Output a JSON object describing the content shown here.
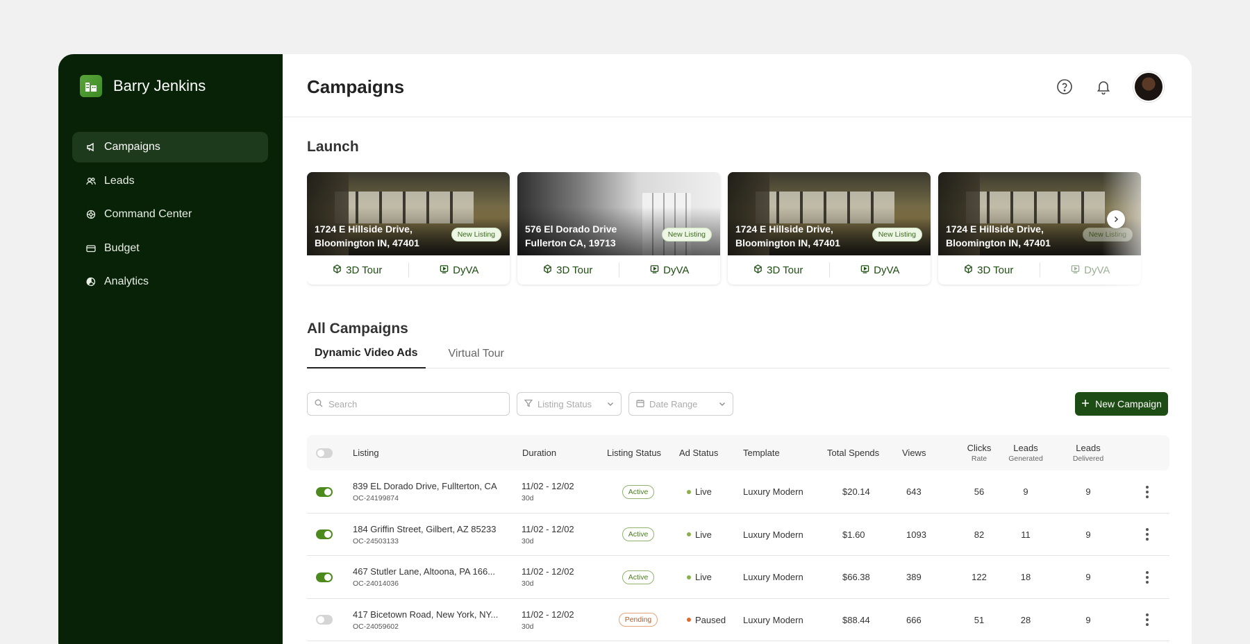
{
  "sidebar": {
    "brand_name": "Barry Jenkins",
    "items": [
      {
        "label": "Campaigns",
        "icon": "megaphone-icon",
        "active": true
      },
      {
        "label": "Leads",
        "icon": "users-icon",
        "active": false
      },
      {
        "label": "Command Center",
        "icon": "command-icon",
        "active": false
      },
      {
        "label": "Budget",
        "icon": "card-icon",
        "active": false
      },
      {
        "label": "Analytics",
        "icon": "pie-chart-icon",
        "active": false
      }
    ]
  },
  "header": {
    "title": "Campaigns",
    "icons": [
      "help-icon",
      "bell-icon",
      "avatar"
    ]
  },
  "launch": {
    "title": "Launch",
    "cards": [
      {
        "address_line1": "1724 E Hillside Drive,",
        "address_line2": "Bloomington IN, 47401",
        "badge": "New Listing",
        "tour_label": "3D Tour",
        "dyva_label": "DyVA"
      },
      {
        "address_line1": "576 El Dorado Drive",
        "address_line2": "Fullerton CA, 19713",
        "badge": "New Listing",
        "tour_label": "3D Tour",
        "dyva_label": "DyVA"
      },
      {
        "address_line1": "1724 E Hillside Drive,",
        "address_line2": "Bloomington IN, 47401",
        "badge": "New Listing",
        "tour_label": "3D Tour",
        "dyva_label": "DyVA"
      },
      {
        "address_line1": "1724 E Hillside Drive,",
        "address_line2": "Bloomington IN, 47401",
        "badge": "New Listing",
        "tour_label": "3D Tour",
        "dyva_label": "DyVA"
      }
    ]
  },
  "campaigns": {
    "title": "All Campaigns",
    "tabs": [
      {
        "label": "Dynamic Video Ads",
        "active": true
      },
      {
        "label": "Virtual Tour",
        "active": false
      }
    ],
    "filters": {
      "search_placeholder": "Search",
      "listing_status": "Listing Status",
      "date_range": "Date Range"
    },
    "new_button": "New Campaign",
    "columns": {
      "listing": "Listing",
      "duration": "Duration",
      "listing_status": "Listing Status",
      "ad_status": "Ad Status",
      "template": "Template",
      "total_spends": "Total Spends",
      "views": "Views",
      "clicks": "Clicks",
      "clicks_sub": "Rate",
      "leads_gen": "Leads",
      "leads_gen_sub": "Generated",
      "leads_del": "Leads",
      "leads_del_sub": "Delivered"
    },
    "rows": [
      {
        "enabled": true,
        "listing": "839 EL Dorado Drive, Fullterton, CA",
        "id": "OC-24199874",
        "duration": "11/02 - 12/02",
        "days": "30d",
        "listing_status": "Active",
        "ad_status": "Live",
        "template": "Luxury Modern",
        "spend": "$20.14",
        "views": "643",
        "clicks": "56",
        "leads_generated": "9",
        "leads_delivered": "9"
      },
      {
        "enabled": true,
        "listing": "184 Griffin Street, Gilbert, AZ 85233",
        "id": "OC-24503133",
        "duration": "11/02 - 12/02",
        "days": "30d",
        "listing_status": "Active",
        "ad_status": "Live",
        "template": "Luxury Modern",
        "spend": "$1.60",
        "views": "1093",
        "clicks": "82",
        "leads_generated": "11",
        "leads_delivered": "9"
      },
      {
        "enabled": true,
        "listing": "467 Stutler Lane, Altoona, PA 166...",
        "id": "OC-24014036",
        "duration": "11/02 - 12/02",
        "days": "30d",
        "listing_status": "Active",
        "ad_status": "Live",
        "template": "Luxury Modern",
        "spend": "$66.38",
        "views": "389",
        "clicks": "122",
        "leads_generated": "18",
        "leads_delivered": "9"
      },
      {
        "enabled": false,
        "listing": "417 Bicetown Road, New York, NY...",
        "id": "OC-24059602",
        "duration": "11/02 - 12/02",
        "days": "30d",
        "listing_status": "Pending",
        "ad_status": "Paused",
        "template": "Luxury Modern",
        "spend": "$88.44",
        "views": "666",
        "clicks": "51",
        "leads_generated": "28",
        "leads_delivered": "9"
      }
    ]
  },
  "colors": {
    "sidebar_bg": "#072207",
    "primary_button": "#1d4d14",
    "live_dot": "#8bb04a",
    "paused_dot": "#e06a2c"
  }
}
